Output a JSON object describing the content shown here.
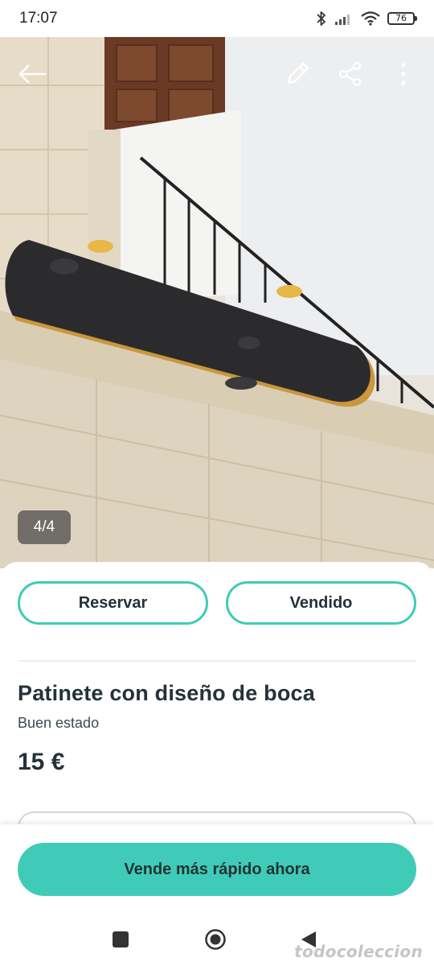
{
  "status_bar": {
    "time": "17:07",
    "battery": "76",
    "icons": [
      "bluetooth-icon",
      "signal-icon",
      "wifi-icon",
      "battery-icon"
    ]
  },
  "toolbar": {
    "icons": [
      "back-arrow-icon",
      "edit-pencil-icon",
      "share-icon",
      "more-vertical-icon"
    ]
  },
  "gallery": {
    "counter": "4/4"
  },
  "actions": {
    "reserve_label": "Reservar",
    "sold_label": "Vendido"
  },
  "listing": {
    "title": "Patinete con diseño de boca",
    "condition": "Buen estado",
    "price": "15 €"
  },
  "cta": {
    "label": "Vende más rápido ahora"
  },
  "watermark": "todocoleccion",
  "colors": {
    "accent": "#3fcbb7",
    "text": "#253238"
  }
}
